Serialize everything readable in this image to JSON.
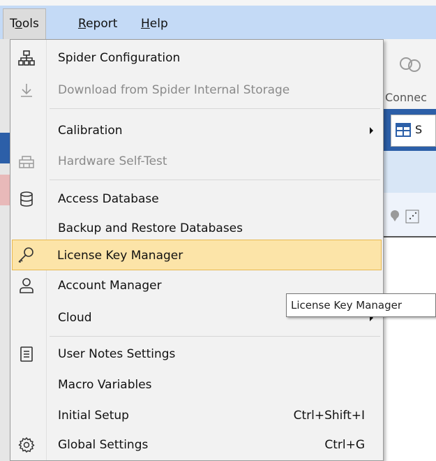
{
  "menubar": {
    "items": [
      {
        "label": "Tools",
        "accel": "o"
      },
      {
        "label": "Report",
        "accel": "R"
      },
      {
        "label": "Help",
        "accel": "H"
      }
    ]
  },
  "background": {
    "connect_label": "Connec",
    "tab_label": "S"
  },
  "dropdown": {
    "items": [
      {
        "label": "Spider Configuration",
        "icon": "sitemap-icon"
      },
      {
        "label": "Download from Spider Internal Storage",
        "icon": "download-icon",
        "disabled": true
      },
      {
        "label": "Calibration",
        "submenu": true
      },
      {
        "label": "Hardware Self-Test",
        "icon": "hardware-icon",
        "disabled": true
      },
      {
        "label": "Access Database",
        "icon": "database-icon"
      },
      {
        "label": "Backup and Restore Databases"
      },
      {
        "label": "License Key Manager",
        "icon": "key-icon",
        "highlighted": true
      },
      {
        "label": "Account Manager",
        "icon": "user-icon"
      },
      {
        "label": "Cloud",
        "submenu": true
      },
      {
        "label": "User Notes Settings",
        "icon": "notes-icon"
      },
      {
        "label": "Macro Variables"
      },
      {
        "label": "Initial Setup",
        "shortcut": "Ctrl+Shift+I"
      },
      {
        "label": "Global Settings",
        "icon": "gear-icon",
        "shortcut": "Ctrl+G"
      }
    ]
  },
  "tooltip": {
    "text": "License Key Manager"
  },
  "colors": {
    "menubar_bg": "#c4daf6",
    "menu_bg": "#f2f2f2",
    "highlight_bg": "#fce4a8",
    "highlight_border": "#e8b84f",
    "disabled_text": "#8a8a8a"
  }
}
